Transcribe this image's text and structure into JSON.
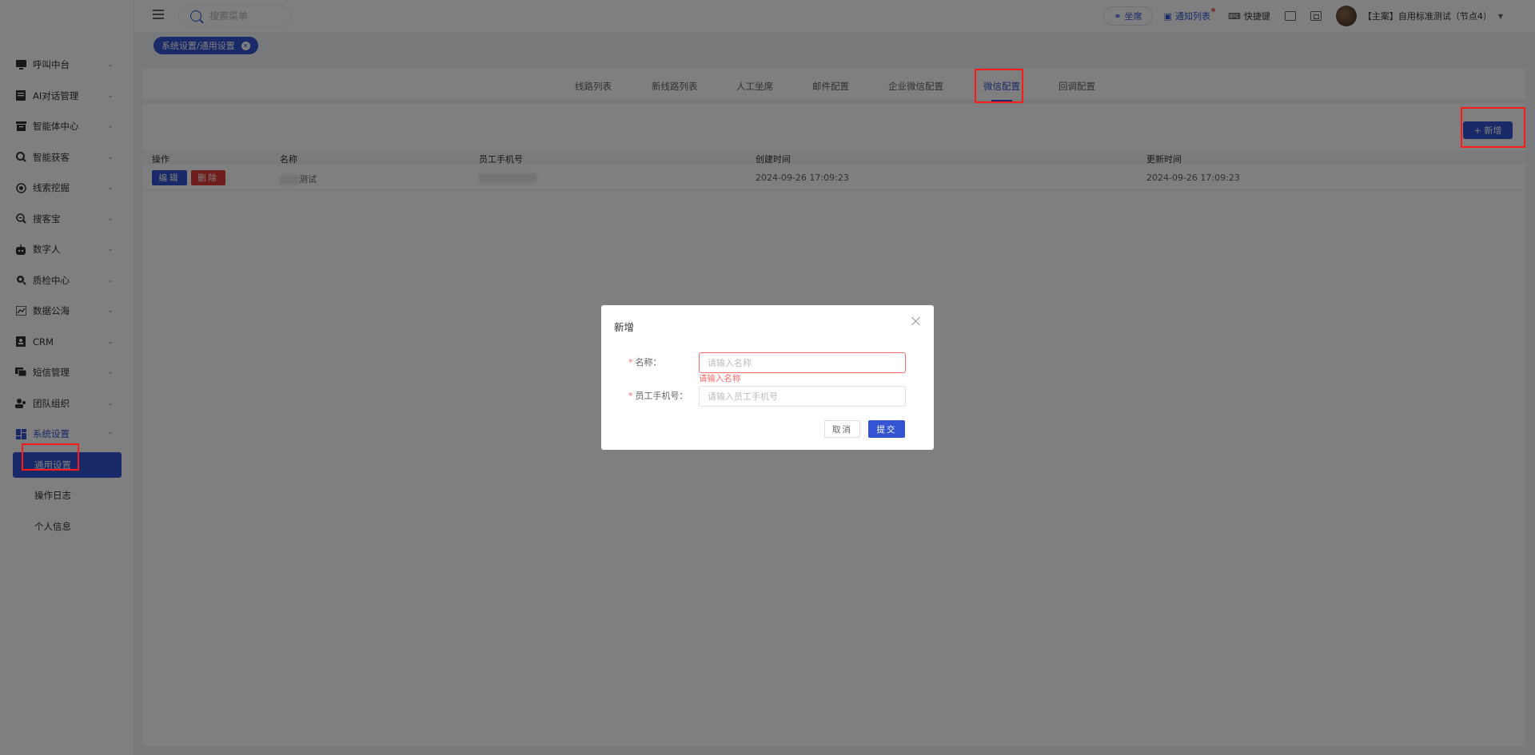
{
  "sidebar": {
    "items": [
      {
        "label": "呼叫中台",
        "icon": "monitor-icon"
      },
      {
        "label": "AI对话管理",
        "icon": "document-icon"
      },
      {
        "label": "智能体中心",
        "icon": "archive-icon"
      },
      {
        "label": "智能获客",
        "icon": "search-icon"
      },
      {
        "label": "线索挖掘",
        "icon": "target-icon"
      },
      {
        "label": "搜客宝",
        "icon": "magnifier-icon"
      },
      {
        "label": "数字人",
        "icon": "robot-icon"
      },
      {
        "label": "质检中心",
        "icon": "inspect-icon"
      },
      {
        "label": "数据公海",
        "icon": "chart-icon"
      },
      {
        "label": "CRM",
        "icon": "contact-icon"
      },
      {
        "label": "短信管理",
        "icon": "message-icon"
      },
      {
        "label": "团队组织",
        "icon": "team-icon"
      },
      {
        "label": "系统设置",
        "icon": "dashboard-icon"
      }
    ],
    "sub_items": [
      "通用设置",
      "操作日志",
      "个人信息"
    ]
  },
  "topbar": {
    "search_placeholder": "搜索菜单",
    "seat_label": "坐席",
    "notify_label": "通知列表",
    "shortcut_label": "快捷键",
    "user_name": "【主案】自用标准测试（节点4）"
  },
  "tagbar": {
    "tag_label": "系统设置/通用设置"
  },
  "tabs": [
    "线路列表",
    "新线路列表",
    "人工坐席",
    "邮件配置",
    "企业微信配置",
    "微信配置",
    "回调配置"
  ],
  "toolbar": {
    "add_label": "+ 新增"
  },
  "table": {
    "headers": [
      "操作",
      "名称",
      "员工手机号",
      "创建时间",
      "更新时间"
    ],
    "rows": [
      {
        "edit": "编辑",
        "delete": "删除",
        "name_suffix": "测试",
        "created": "2024-09-26 17:09:23",
        "updated": "2024-09-26 17:09:23"
      }
    ]
  },
  "dialog": {
    "title": "新增",
    "name_label": "名称：",
    "name_placeholder": "请输入名称",
    "name_error": "请输入名称",
    "phone_label": "员工手机号：",
    "phone_placeholder": "请输入员工手机号",
    "cancel_label": "取消",
    "submit_label": "提交"
  },
  "colors": {
    "accent": "#3554d1",
    "danger": "#e03b3b",
    "annotation": "#ff1a1a"
  }
}
